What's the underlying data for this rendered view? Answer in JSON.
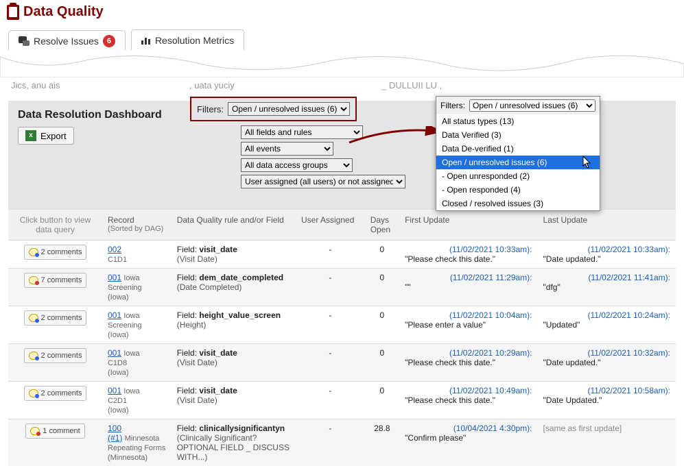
{
  "page_title": "Data Quality",
  "tabs": [
    {
      "label": "Resolve Issues",
      "badge": "6",
      "active": true
    },
    {
      "label": "Resolution Metrics",
      "active": false
    }
  ],
  "fragments": {
    "left": "Jics, anu ais",
    "mid": ", uata yuciy",
    "right": "_ DULLUII LU ,"
  },
  "dashboard": {
    "title": "Data Resolution Dashboard",
    "filters_label": "Filters:",
    "main_filter": "Open / unresolved issues (6)",
    "fields_rules_filter": "All fields and rules",
    "events_filter": "All events",
    "dag_filter": "All data access groups",
    "users_filter": "User assigned (all users) or not assigned",
    "export_label": "Export"
  },
  "popup": {
    "label": "Filters:",
    "selected": "Open / unresolved issues (6)",
    "options": [
      "All status types (13)",
      "Data Verified (3)",
      "Data De-verified (1)",
      "Open / unresolved issues (6)",
      "- Open unresponded (2)",
      "- Open responded (4)",
      "Closed / resolved issues (3)"
    ],
    "selected_index": 3
  },
  "table": {
    "headers": {
      "actions": "Click button to view data query",
      "record": "Record",
      "record_sub": "(Sorted by DAG)",
      "rule": "Data Quality rule and/or Field",
      "user": "User Assigned",
      "days": "Days Open",
      "first": "First Update",
      "last": "Last Update"
    },
    "rows": [
      {
        "btn": "2 comments",
        "bubble": "blue",
        "rec": "002",
        "rec_sub": "C1D1",
        "field_label": "Field:",
        "field_name": "visit_date",
        "field_paren": "(Visit Date)",
        "user": "-",
        "days": "0",
        "first_time": "(11/02/2021 10:33am):",
        "first_msg": "\"Please check this date.\"",
        "last_time": "(11/02/2021 10:33am):",
        "last_msg": "\"Date updated.\""
      },
      {
        "btn": "7 comments",
        "bubble": "red",
        "rec": "001",
        "rec_extra": "Iowa",
        "rec_sub": "Screening",
        "rec_sub2": "(Iowa)",
        "field_label": "Field:",
        "field_name": "dem_date_completed",
        "field_paren": "(Date Completed)",
        "user": "-",
        "days": "0",
        "first_time": "(11/02/2021 11:29am):",
        "first_msg": "\"\"",
        "last_time": "(11/02/2021 11:41am):",
        "last_msg": "\"dfg\""
      },
      {
        "btn": "2 comments",
        "bubble": "blue",
        "rec": "001",
        "rec_extra": "Iowa",
        "rec_sub": "Screening",
        "rec_sub2": "(Iowa)",
        "field_label": "Field:",
        "field_name": "height_value_screen",
        "field_paren": "(Height)",
        "user": "-",
        "days": "0",
        "first_time": "(11/02/2021 10:04am):",
        "first_msg": "\"Please enter a value\"",
        "last_time": "(11/02/2021 10:24am):",
        "last_msg": "\"Updated\""
      },
      {
        "btn": "2 comments",
        "bubble": "blue",
        "rec": "001",
        "rec_extra": "Iowa",
        "rec_sub": "C1D8",
        "rec_sub2": "(Iowa)",
        "field_label": "Field:",
        "field_name": "visit_date",
        "field_paren": "(Visit Date)",
        "user": "-",
        "days": "0",
        "first_time": "(11/02/2021 10:29am):",
        "first_msg": "\"Please check this date.\"",
        "last_time": "(11/02/2021 10:32am):",
        "last_msg": "\"Date updated.\""
      },
      {
        "btn": "2 comments",
        "bubble": "blue",
        "rec": "001",
        "rec_extra": "Iowa",
        "rec_sub": "C2D1",
        "rec_sub2": "(Iowa)",
        "field_label": "Field:",
        "field_name": "visit_date",
        "field_paren": "(Visit Date)",
        "user": "-",
        "days": "0",
        "first_time": "(11/02/2021 10:49am):",
        "first_msg": "\"Please check this date.\"",
        "last_time": "(11/02/2021 10:58am):",
        "last_msg": "\"Date Updated.\""
      },
      {
        "btn": "1 comment",
        "bubble": "red",
        "rec": "100",
        "rec_hash": "(#1)",
        "rec_extra": "Minnesota",
        "rec_sub": "Repeating Forms",
        "rec_sub2": "(Minnesota)",
        "field_label": "Field:",
        "field_name": "clinicallysignificantyn",
        "field_paren": "(Clinically Significant? OPTIONAL FIELD _ DISCUSS WITH...)",
        "user": "-",
        "days": "28.8",
        "first_time": "(10/04/2021 4:30pm):",
        "first_msg": "\"Confirm please\"",
        "last_same": "[same as first update]"
      }
    ]
  }
}
